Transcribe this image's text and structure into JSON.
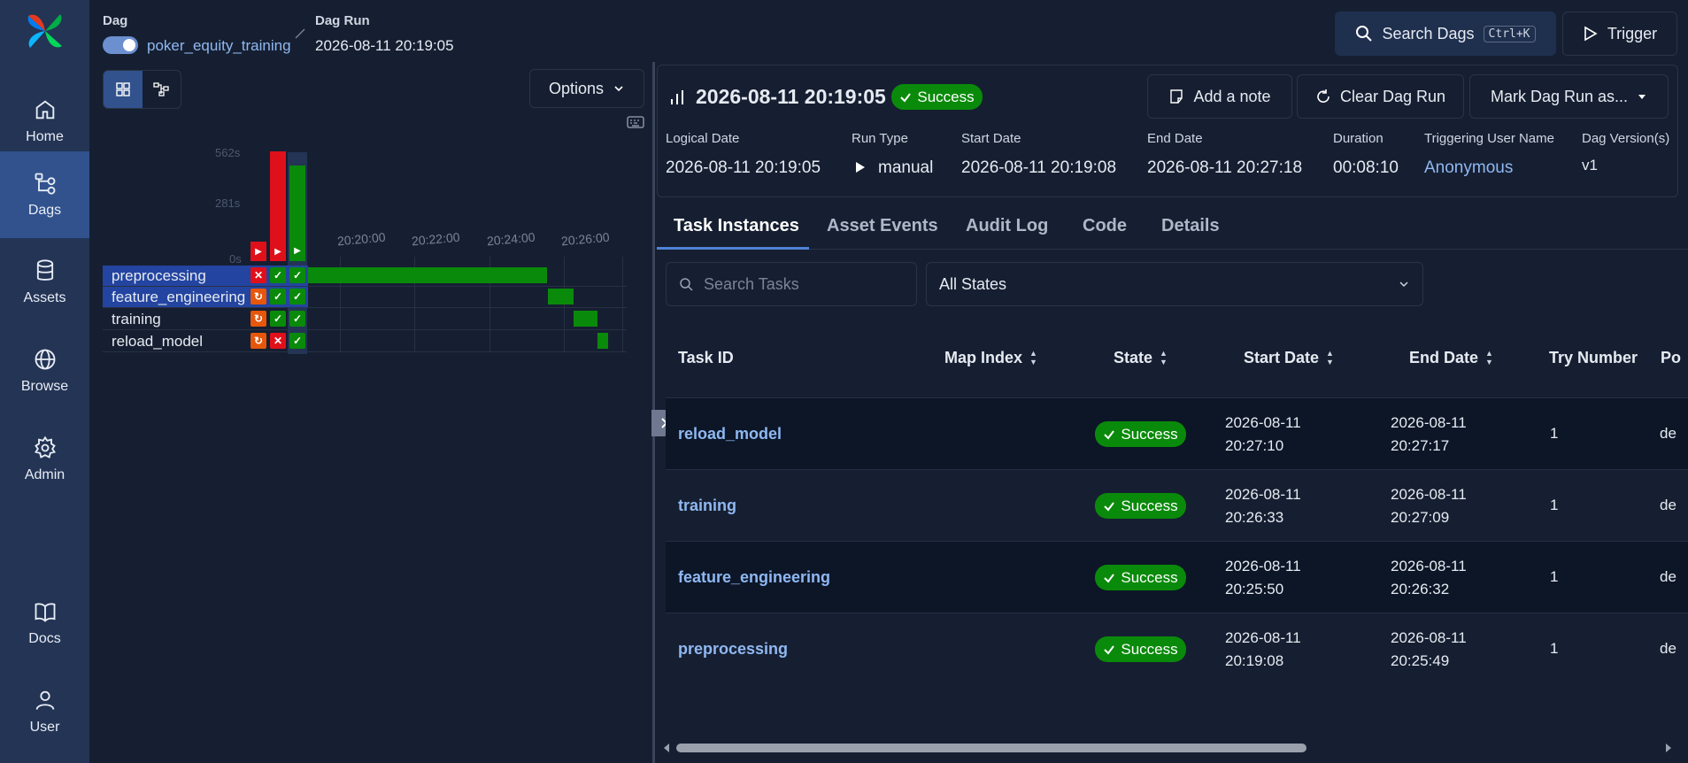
{
  "nav": {
    "items": [
      {
        "label": "Home",
        "icon": "home-icon"
      },
      {
        "label": "Dags",
        "icon": "dags-icon"
      },
      {
        "label": "Assets",
        "icon": "database-icon"
      },
      {
        "label": "Browse",
        "icon": "globe-icon"
      },
      {
        "label": "Admin",
        "icon": "gear-icon"
      },
      {
        "label": "Docs",
        "icon": "book-icon"
      },
      {
        "label": "User",
        "icon": "user-icon"
      }
    ],
    "active": "Dags"
  },
  "breadcrumb": {
    "dag_label": "Dag",
    "dag_name": "poker_equity_training",
    "dag_run_label": "Dag Run",
    "dag_run_value": "2026-08-11 20:19:05"
  },
  "topbar": {
    "search_label": "Search Dags",
    "search_shortcut": "Ctrl+K",
    "trigger_label": "Trigger"
  },
  "grid": {
    "options_label": "Options",
    "duration_ticks": [
      "562s",
      "281s",
      "0s"
    ],
    "time_ticks": [
      "20:20:00",
      "20:22:00",
      "20:24:00",
      "20:26:00"
    ],
    "tasks": [
      {
        "name": "preprocessing",
        "states": [
          "failed",
          "success",
          "success"
        ],
        "gantt_start": 0.0,
        "gantt_end": 0.76
      },
      {
        "name": "feature_engineering",
        "states": [
          "retry",
          "success",
          "success"
        ],
        "gantt_start": 0.763,
        "gantt_end": 0.845
      },
      {
        "name": "training",
        "states": [
          "retry",
          "success",
          "success"
        ],
        "gantt_start": 0.845,
        "gantt_end": 0.92
      },
      {
        "name": "reload_model",
        "states": [
          "retry",
          "failed",
          "success"
        ],
        "gantt_start": 0.92,
        "gantt_end": 0.955
      }
    ],
    "runs": [
      {
        "duration": 0.14,
        "state": "failed"
      },
      {
        "duration": 1.0,
        "state": "failed"
      },
      {
        "duration": 0.87,
        "state": "success"
      }
    ]
  },
  "run": {
    "title": "2026-08-11 20:19:05",
    "status": "Success",
    "add_note": "Add a note",
    "clear": "Clear Dag Run",
    "mark": "Mark Dag Run as...",
    "meta": [
      {
        "label": "Logical Date",
        "value": "2026-08-11 20:19:05"
      },
      {
        "label": "Run Type",
        "value": "manual"
      },
      {
        "label": "Start Date",
        "value": "2026-08-11 20:19:08"
      },
      {
        "label": "End Date",
        "value": "2026-08-11 20:27:18"
      },
      {
        "label": "Duration",
        "value": "00:08:10"
      },
      {
        "label": "Triggering User Name",
        "value": "Anonymous"
      },
      {
        "label": "Dag Version(s)",
        "value": "v1"
      }
    ]
  },
  "tabs": [
    "Task Instances",
    "Asset Events",
    "Audit Log",
    "Code",
    "Details"
  ],
  "filters": {
    "search_placeholder": "Search Tasks",
    "state_value": "All States"
  },
  "table": {
    "columns": [
      "Task ID",
      "Map Index",
      "State",
      "Start Date",
      "End Date",
      "Try Number",
      "Po"
    ],
    "rows": [
      {
        "task_id": "reload_model",
        "state": "Success",
        "start_date": "2026-08-11",
        "start_time": "20:27:10",
        "end_date": "2026-08-11",
        "end_time": "20:27:17",
        "try": "1",
        "pool": "de"
      },
      {
        "task_id": "training",
        "state": "Success",
        "start_date": "2026-08-11",
        "start_time": "20:26:33",
        "end_date": "2026-08-11",
        "end_time": "20:27:09",
        "try": "1",
        "pool": "de"
      },
      {
        "task_id": "feature_engineering",
        "state": "Success",
        "start_date": "2026-08-11",
        "start_time": "20:25:50",
        "end_date": "2026-08-11",
        "end_time": "20:26:32",
        "try": "1",
        "pool": "de"
      },
      {
        "task_id": "preprocessing",
        "state": "Success",
        "start_date": "2026-08-11",
        "start_time": "20:19:08",
        "end_date": "2026-08-11",
        "end_time": "20:25:49",
        "try": "1",
        "pool": "de"
      }
    ]
  },
  "colors": {
    "success": "#0a8a0a",
    "failed": "#e0101a",
    "retry": "#e6560b",
    "accent": "#4f83d8"
  }
}
